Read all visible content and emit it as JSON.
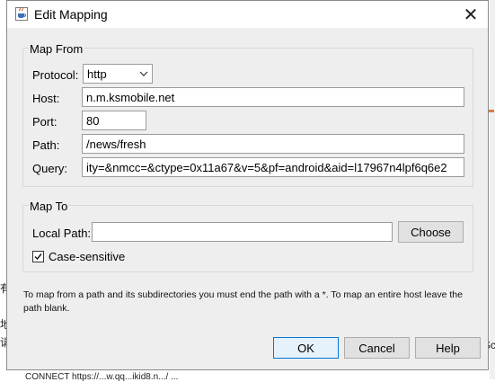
{
  "background": {
    "fragment_a": "有",
    "fragment_b": "地",
    "fragment_c": "请",
    "fragment_d": "Sc",
    "fragment_e": "CONNECT https://...w.qq...ikid8.n.../ ..."
  },
  "dialog": {
    "title": "Edit Mapping",
    "icons": {
      "app": "java-cup-icon",
      "close": "close-icon"
    },
    "close_glyph": "✕"
  },
  "map_from": {
    "title": "Map From",
    "protocol": {
      "label": "Protocol:",
      "value": "http"
    },
    "host": {
      "label": "Host:",
      "value": "n.m.ksmobile.net"
    },
    "port": {
      "label": "Port:",
      "value": "80"
    },
    "path": {
      "label": "Path:",
      "value": "/news/fresh"
    },
    "query": {
      "label": "Query:",
      "value": "ity=&nmcc=&ctype=0x11a67&v=5&pf=android&aid=l17967n4lpf6q6e2"
    }
  },
  "map_to": {
    "title": "Map To",
    "local_path": {
      "label": "Local Path:",
      "value": ""
    },
    "choose_label": "Choose",
    "case_sensitive": {
      "label": "Case-sensitive",
      "checked": true
    }
  },
  "hint": "To map from a path and its subdirectories you must end the path with a *. To map an entire host leave the path blank.",
  "buttons": {
    "ok": "OK",
    "cancel": "Cancel",
    "help": "Help"
  },
  "colors": {
    "dialog_bg": "#eeeeee",
    "ok_border": "#0078d7",
    "ok_bg": "#e5f1fb"
  }
}
